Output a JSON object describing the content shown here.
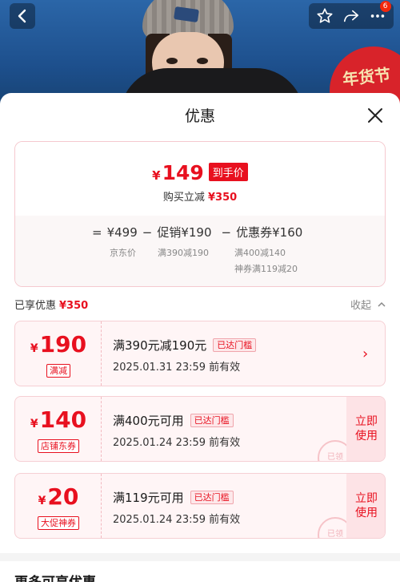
{
  "header": {
    "notification_count": "6",
    "banner_text": "年货节"
  },
  "sheet": {
    "title": "优惠"
  },
  "summary": {
    "currency": "¥",
    "final_price": "149",
    "final_tag": "到手价",
    "reduce_label": "购买立减",
    "reduce_value": "¥350",
    "equals": "=",
    "jd_price": "¥499",
    "jd_price_label": "京东价",
    "minus1": "−",
    "promo": "促销¥190",
    "promo_detail": "满390减190",
    "minus2": "−",
    "coupon": "优惠券¥160",
    "coupon_detail_1": "满400减140",
    "coupon_detail_2": "神券满119减20"
  },
  "enjoyed": {
    "label": "已享优惠",
    "value": "¥350",
    "collapse_label": "收起"
  },
  "coupons": [
    {
      "currency": "¥",
      "amount": "190",
      "type": "满减",
      "title": "满390元减190元",
      "badge": "已达门槛",
      "date": "2025.01.31 23:59 前有效"
    },
    {
      "currency": "¥",
      "amount": "140",
      "type": "店铺东券",
      "title": "满400元可用",
      "badge": "已达门槛",
      "date": "2025.01.24 23:59 前有效",
      "action": "立即使用",
      "stamp": "已领"
    },
    {
      "currency": "¥",
      "amount": "20",
      "type": "大促神券",
      "title": "满119元可用",
      "badge": "已达门槛",
      "date": "2025.01.24 23:59 前有效",
      "action": "立即使用",
      "stamp": "已领"
    }
  ],
  "more": {
    "title": "更多可享优惠"
  },
  "colors": {
    "accent": "#e8101f",
    "badge_bg": "#fde8ea"
  }
}
